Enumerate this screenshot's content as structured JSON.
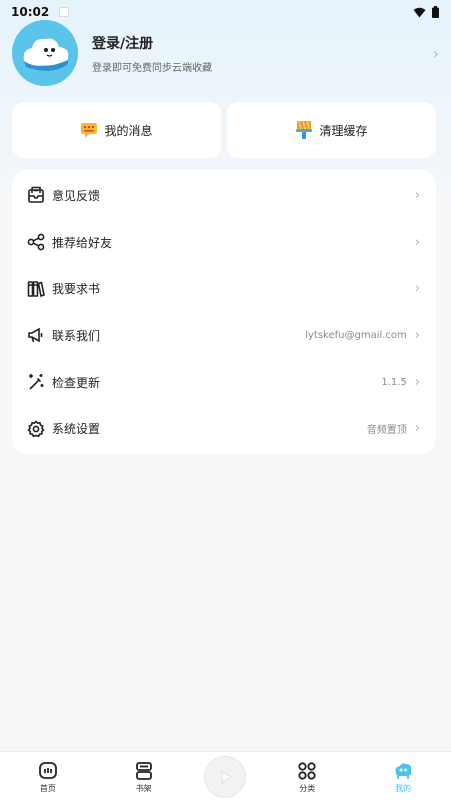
{
  "status_bar": {
    "time": "10:02"
  },
  "profile": {
    "title": "登录/注册",
    "subtitle": "登录即可免费同步云端收藏"
  },
  "quick_actions": [
    {
      "label": "我的消息",
      "icon": "message-icon"
    },
    {
      "label": "清理缓存",
      "icon": "brush-icon"
    }
  ],
  "menu": {
    "items": [
      {
        "label": "意见反馈",
        "value": "",
        "icon": "feedback-icon"
      },
      {
        "label": "推荐给好友",
        "value": "",
        "icon": "share-icon"
      },
      {
        "label": "我要求书",
        "value": "",
        "icon": "books-icon"
      },
      {
        "label": "联系我们",
        "value": "lytskefu@gmail.com",
        "icon": "megaphone-icon"
      },
      {
        "label": "检查更新",
        "value": "1.1.5",
        "icon": "magic-wand-icon"
      },
      {
        "label": "系统设置",
        "value": "音频置顶",
        "icon": "gear-icon"
      }
    ]
  },
  "bottom_nav": {
    "items": [
      {
        "label": "首页",
        "icon": "home-icon"
      },
      {
        "label": "书架",
        "icon": "bookshelf-icon"
      },
      {
        "label": "分类",
        "icon": "category-icon"
      },
      {
        "label": "我的",
        "icon": "profile-icon"
      }
    ],
    "active_color": "#49c3ee"
  }
}
